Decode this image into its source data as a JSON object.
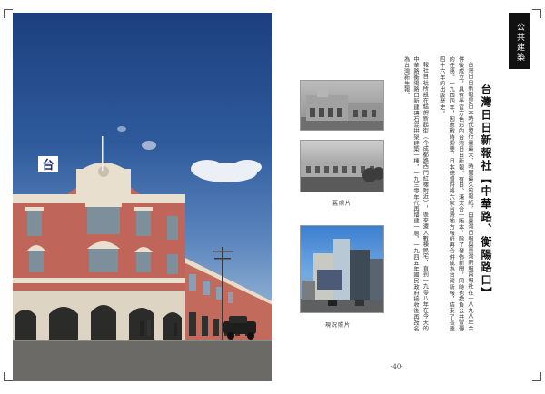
{
  "page": {
    "tag": "公共建築",
    "title": "台灣日日新報社【中華路、衡陽路口】",
    "paragraphs": [
      "台灣日日新報是日本時代發行量最大、時間最久的報紙，由臺灣日報與臺灣新報兩報社在一八九八年合併後成立，具有半官方色彩的台灣日日新報。有日、漢文合一版本，除了發佈新聞，同時也擔負公共宣傳的任務。一九四四年，因應戰時需要，日本總督府將六家台灣地方報紙再合併成為台灣新報，結束了長達四十六年的出版歷史。",
      "報社自社所設在艋舺新起街（今成都路西門紅樓附近），後來遷入數棟民宅，直到一九零八年在今天的中華路衡陽路口新建磚石混拱架建築一棟，一九三零年代再增建一層，一九四五年國民政府接收後再改名為台灣新生報。"
    ],
    "captions": {
      "old_photo": "舊照片",
      "current_photo": "現況照片"
    },
    "sign_char": "台",
    "page_number": "-40-"
  }
}
